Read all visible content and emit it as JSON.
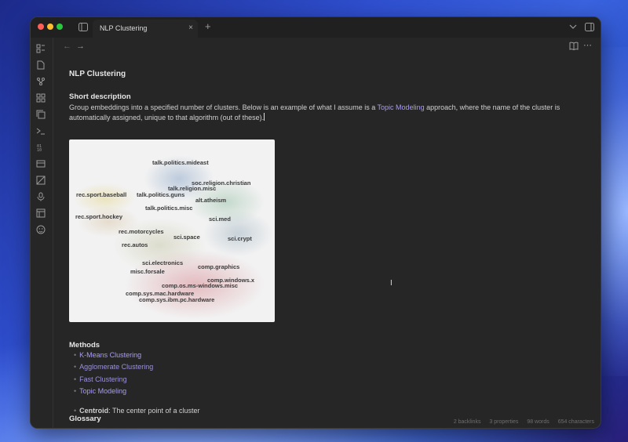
{
  "tab": {
    "title": "NLP Clustering",
    "close": "×",
    "new": "+"
  },
  "titlebar": {
    "sidebar_toggle_icon": "sidebar-toggle-icon",
    "dropdown_icon": "chevron-down-icon",
    "right_sidebar_icon": "right-sidebar-icon"
  },
  "nav": {
    "back": "←",
    "forward": "→",
    "reading_view": "📖",
    "more": "⋯"
  },
  "sidebar_icons": [
    "files-icon",
    "file-icon",
    "graph-icon",
    "grid-icon",
    "copy-icon",
    "terminal-icon",
    "tag-icon",
    "card-icon",
    "canvas-icon",
    "mic-icon",
    "layout-icon",
    "face-icon"
  ],
  "note": {
    "title": "NLP Clustering",
    "short_heading": "Short description",
    "para_before": "Group embeddings into a specified number of clusters. Below is an example of what I assume is a ",
    "para_link": "Topic Modeling",
    "para_after": " approach, where the name of the cluster is automatically assigned, unique to that algorithm (out of these).",
    "cluster_labels": [
      "talk.politics.mideast",
      "soc.religion.christian",
      "talk.religion.misc",
      "rec.sport.baseball",
      "talk.politics.guns",
      "alt.atheism",
      "talk.politics.misc",
      "rec.sport.hockey",
      "sci.med",
      "rec.motorcycles",
      "sci.space",
      "sci.crypt",
      "rec.autos",
      "sci.electronics",
      "comp.graphics",
      "misc.forsale",
      "comp.windows.x",
      "comp.os.ms-windows.misc",
      "comp.sys.mac.hardware",
      "comp.sys.ibm.pc.hardware"
    ],
    "methods_heading": "Methods",
    "methods": [
      "K-Means Clustering",
      "Agglomerate Clustering",
      "Fast Clustering",
      "Topic Modeling"
    ],
    "glossary_heading": "Glossary",
    "glossary_term": "Centroid",
    "glossary_def": ": The center point of a cluster"
  },
  "status": {
    "backlinks": "2 backlinks",
    "properties": "3 properties",
    "words": "98 words",
    "characters": "654 characters"
  },
  "colors": {
    "link": "#a89cf4",
    "background": "#262626",
    "accent_red": "#ff5f57",
    "accent_yellow": "#febc2e",
    "accent_green": "#28c840"
  }
}
